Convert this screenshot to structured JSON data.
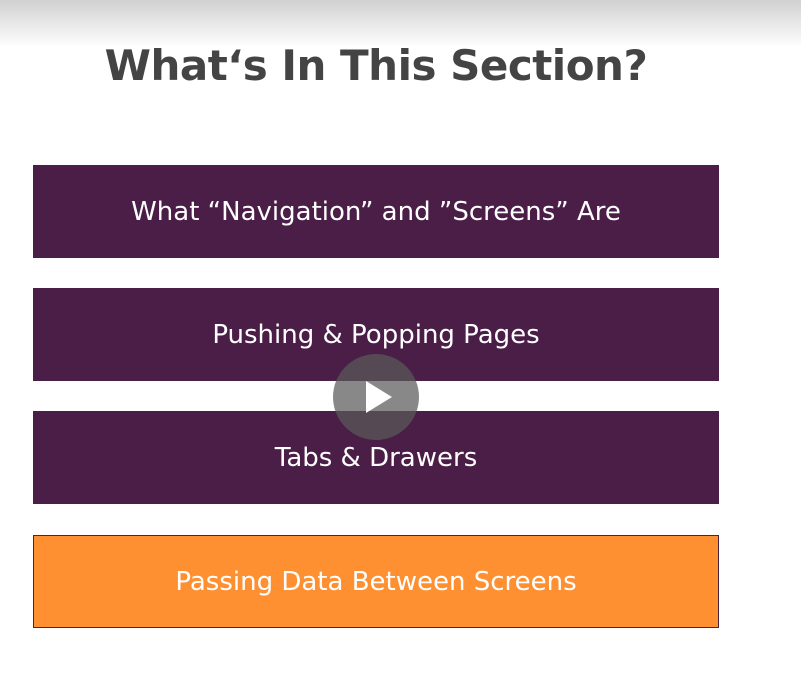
{
  "slide": {
    "title": "What‘s In This Section?",
    "items": [
      {
        "label": "What “Navigation” and ”Screens” Are",
        "color": "#4a1e47"
      },
      {
        "label": "Pushing & Popping Pages",
        "color": "#4a1e47"
      },
      {
        "label": "Tabs & Drawers",
        "color": "#4a1e47"
      },
      {
        "label": "Passing Data Between Screens",
        "color": "#ff9031"
      }
    ]
  },
  "player": {
    "play_icon": "play-icon"
  }
}
